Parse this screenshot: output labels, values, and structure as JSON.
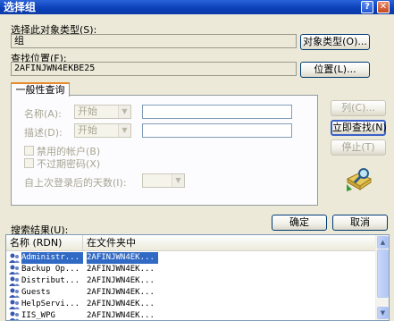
{
  "window": {
    "title": "选择组",
    "help_label": "?",
    "close_label": "✕"
  },
  "object_type": {
    "label": "选择此对象类型(S):",
    "value": "组",
    "button": "对象类型(O)..."
  },
  "location": {
    "label": "查找位置(F):",
    "value": "2AFINJWN4EKBE25",
    "button": "位置(L)..."
  },
  "query_tab": {
    "label": "一般性查询",
    "name_label": "名称(A):",
    "name_mode": "开始",
    "desc_label": "描述(D):",
    "desc_mode": "开始",
    "disabled_accounts": "禁用的帐户(B)",
    "no_expire_pw": "不过期密码(X)",
    "days_since_logon": "自上次登录后的天数(I):"
  },
  "side_buttons": {
    "columns": "列(C)...",
    "find_now": "立即查找(N)",
    "stop": "停止(T)"
  },
  "icons": {
    "search_graphic": "search-animation-icon",
    "group": "group-icon"
  },
  "results": {
    "label": "搜索结果(U):",
    "ok": "确定",
    "cancel": "取消",
    "columns": [
      "名称 (RDN)",
      "在文件夹中"
    ],
    "rows": [
      {
        "name": "Administr...",
        "folder": "2AFINJWN4EK..."
      },
      {
        "name": "Backup Op...",
        "folder": "2AFINJWN4EK..."
      },
      {
        "name": "Distribut...",
        "folder": "2AFINJWN4EK..."
      },
      {
        "name": "Guests",
        "folder": "2AFINJWN4EK..."
      },
      {
        "name": "HelpServi...",
        "folder": "2AFINJWN4EK..."
      },
      {
        "name": "IIS_WPG",
        "folder": "2AFINJWN4EK..."
      }
    ]
  },
  "colors": {
    "titlebar": "#0a3fb7",
    "selection": "#316ac5",
    "tab_accent": "#e68b2c",
    "dialog_bg": "#ece9d8"
  }
}
